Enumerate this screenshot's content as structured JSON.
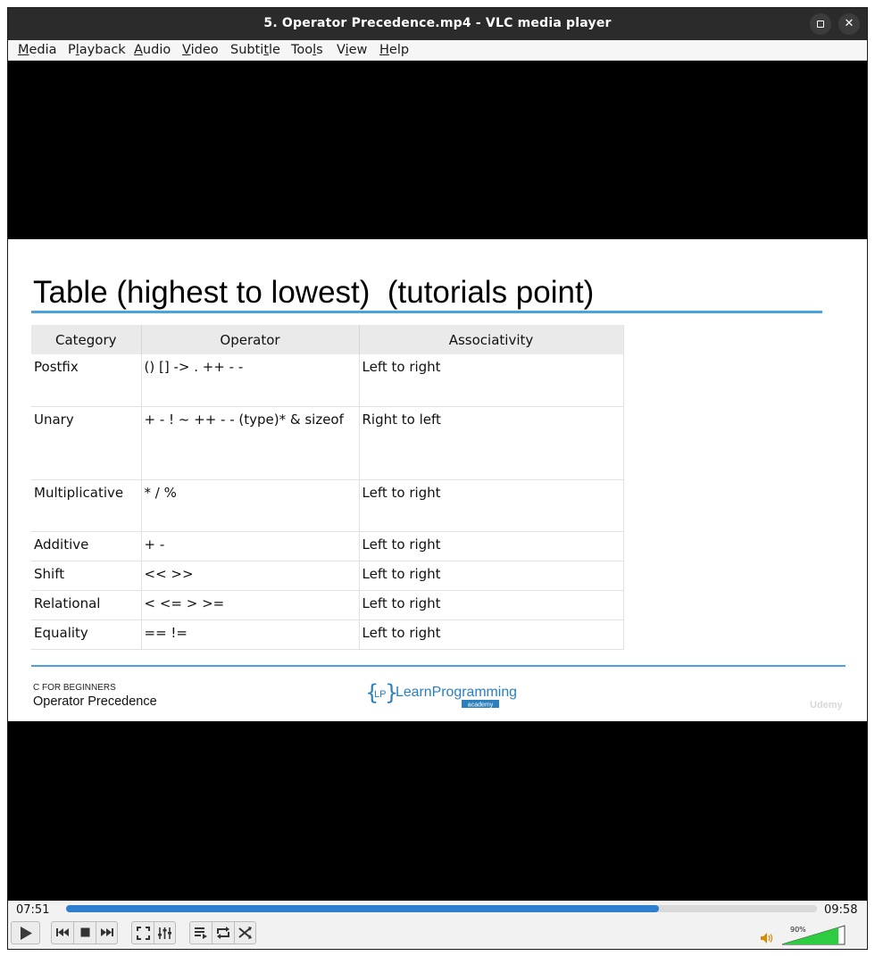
{
  "window": {
    "title": "5. Operator Precedence.mp4 - VLC media player",
    "buttons": {
      "maximize_icon": "maximize-icon",
      "close_glyph": "✕"
    }
  },
  "menubar": [
    {
      "pre": "",
      "key": "M",
      "post": "edia"
    },
    {
      "pre": "P",
      "key": "l",
      "post": "ayback"
    },
    {
      "pre": "",
      "key": "A",
      "post": "udio"
    },
    {
      "pre": "",
      "key": "V",
      "post": "ideo"
    },
    {
      "pre": "Subti",
      "key": "t",
      "post": "le"
    },
    {
      "pre": "Too",
      "key": "l",
      "post": "s"
    },
    {
      "pre": "V",
      "key": "i",
      "post": "ew"
    },
    {
      "pre": "",
      "key": "H",
      "post": "elp"
    }
  ],
  "slide": {
    "title": "Table (highest to lowest)  (tutorials point)",
    "table": {
      "headers": [
        "Category",
        "Operator",
        "Associativity"
      ],
      "rows": [
        [
          "Postfix",
          "() [] -> . ++ - -",
          "Left to right"
        ],
        [
          "Unary",
          "+ - ! ~ ++ - - (type)* & sizeof",
          "Right to left"
        ],
        [
          "Multiplicative",
          "* / %",
          "Left to right"
        ],
        [
          "Additive",
          "+ -",
          "Left to right"
        ],
        [
          "Shift",
          "<< >>",
          "Left to right"
        ],
        [
          "Relational",
          "< <= > >=",
          "Left to right"
        ],
        [
          "Equality",
          "== !=",
          "Left to right"
        ]
      ]
    },
    "footer": {
      "course": "C FOR BEGINNERS",
      "lesson": "Operator Precedence",
      "logo_text": "LearnProgramming",
      "logo_sub": "academy",
      "watermark": "Udemy"
    }
  },
  "controls": {
    "elapsed": "07:51",
    "total": "09:58",
    "progress": 0.79,
    "volume": "90%",
    "volume_level": 0.9,
    "colors": {
      "seek": "#2f7fd0",
      "volume": "#2ecc40"
    },
    "icons": [
      "play-icon",
      "previous-icon",
      "stop-icon",
      "next-icon",
      "fullscreen-icon",
      "extended-settings-icon",
      "playlist-icon",
      "loop-icon",
      "shuffle-icon",
      "volume-icon"
    ]
  }
}
